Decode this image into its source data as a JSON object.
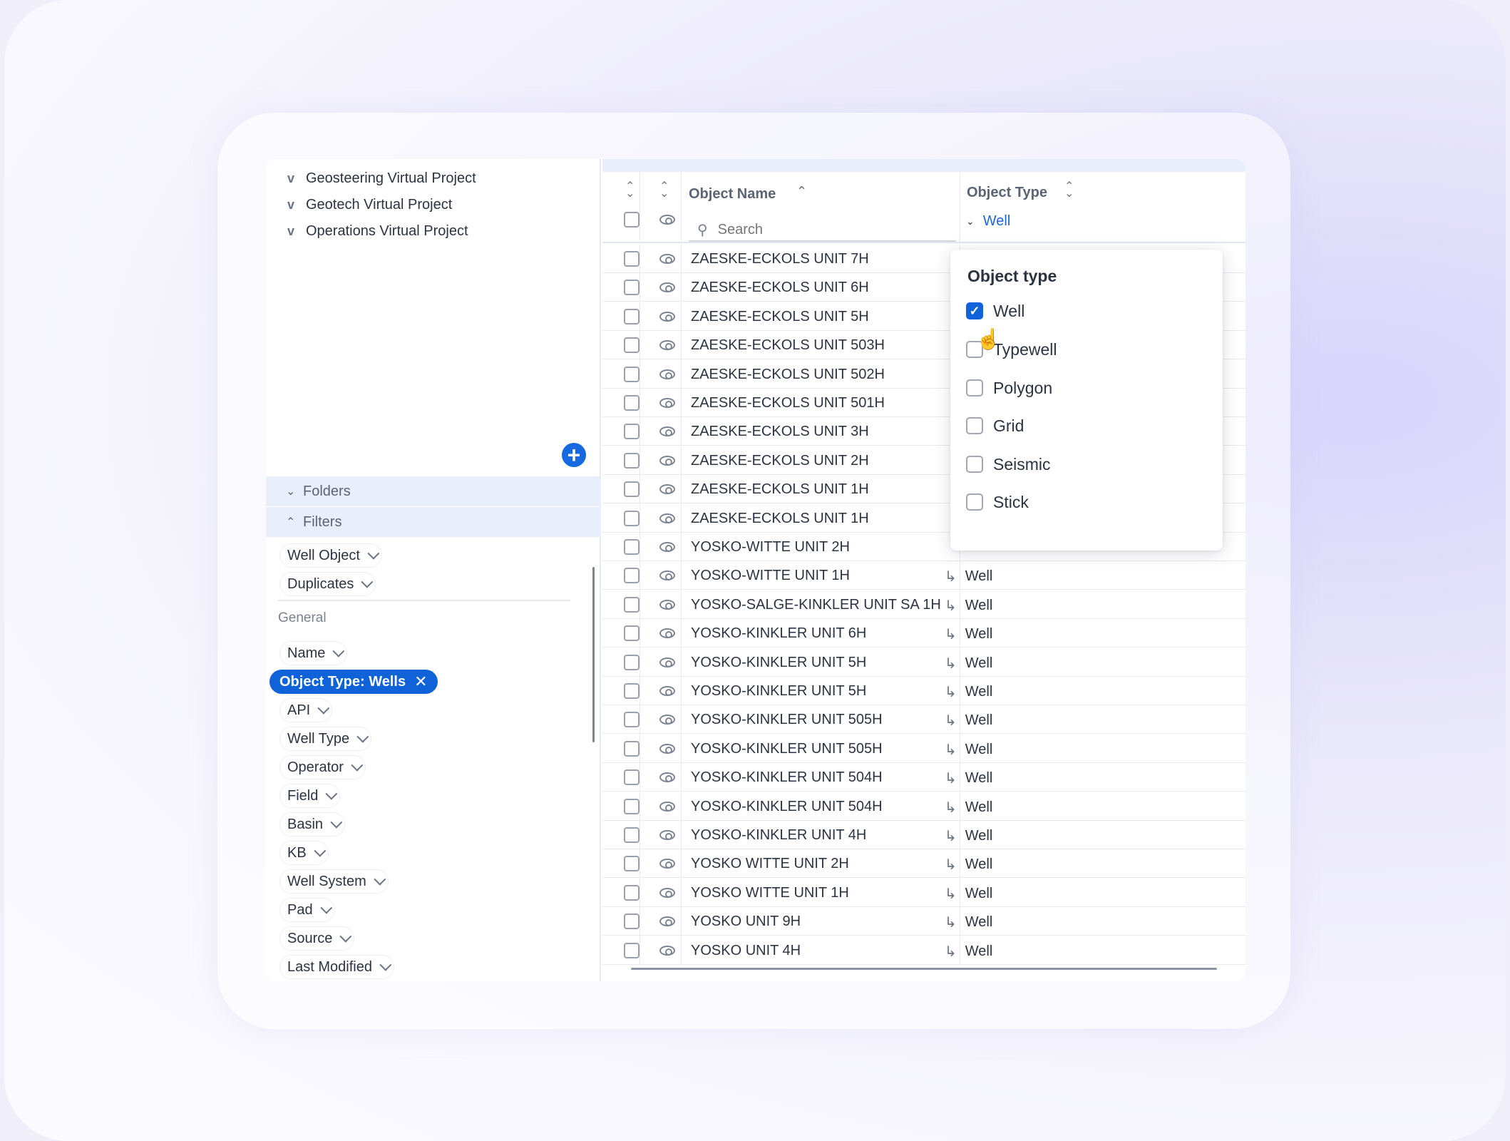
{
  "projects": [
    {
      "label": "Geosteering Virtual Project"
    },
    {
      "label": "Geotech Virtual Project"
    },
    {
      "label": "Operations Virtual Project"
    }
  ],
  "sections": {
    "folders": "Folders",
    "filters": "Filters"
  },
  "filters": {
    "top": [
      "Well Object",
      "Duplicates"
    ],
    "general_label": "General",
    "name": "Name",
    "active_chip": "Object Type: Wells",
    "items": [
      "API",
      "Well Type",
      "Operator",
      "Field",
      "Basin",
      "KB",
      "Well System",
      "Pad",
      "Source",
      "Last Modified"
    ]
  },
  "table": {
    "col_name": "Object Name",
    "col_type": "Object Type",
    "search_placeholder": "Search",
    "type_filter_value": "Well",
    "rows": [
      {
        "name": "ZAESKE-ECKOLS UNIT 7H",
        "type": ""
      },
      {
        "name": "ZAESKE-ECKOLS UNIT 6H",
        "type": ""
      },
      {
        "name": "ZAESKE-ECKOLS UNIT 5H",
        "type": ""
      },
      {
        "name": "ZAESKE-ECKOLS UNIT 503H",
        "type": ""
      },
      {
        "name": "ZAESKE-ECKOLS UNIT 502H",
        "type": ""
      },
      {
        "name": "ZAESKE-ECKOLS UNIT 501H",
        "type": ""
      },
      {
        "name": "ZAESKE-ECKOLS UNIT 3H",
        "type": ""
      },
      {
        "name": "ZAESKE-ECKOLS UNIT 2H",
        "type": ""
      },
      {
        "name": "ZAESKE-ECKOLS UNIT 1H",
        "type": ""
      },
      {
        "name": "ZAESKE-ECKOLS UNIT 1H",
        "type": ""
      },
      {
        "name": "YOSKO-WITTE UNIT 2H",
        "type": ""
      },
      {
        "name": "YOSKO-WITTE UNIT 1H",
        "type": "Well"
      },
      {
        "name": "YOSKO-SALGE-KINKLER UNIT SA 1H",
        "type": "Well"
      },
      {
        "name": "YOSKO-KINKLER UNIT 6H",
        "type": "Well"
      },
      {
        "name": "YOSKO-KINKLER UNIT 5H",
        "type": "Well"
      },
      {
        "name": "YOSKO-KINKLER UNIT 5H",
        "type": "Well"
      },
      {
        "name": "YOSKO-KINKLER UNIT 505H",
        "type": "Well"
      },
      {
        "name": "YOSKO-KINKLER UNIT 505H",
        "type": "Well"
      },
      {
        "name": "YOSKO-KINKLER UNIT 504H",
        "type": "Well"
      },
      {
        "name": "YOSKO-KINKLER UNIT 504H",
        "type": "Well"
      },
      {
        "name": "YOSKO-KINKLER UNIT 4H",
        "type": "Well"
      },
      {
        "name": "YOSKO WITTE UNIT 2H",
        "type": "Well"
      },
      {
        "name": "YOSKO WITTE UNIT 1H",
        "type": "Well"
      },
      {
        "name": "YOSKO UNIT 9H",
        "type": "Well"
      },
      {
        "name": "YOSKO UNIT 4H",
        "type": "Well"
      }
    ]
  },
  "popover": {
    "title": "Object type",
    "options": [
      {
        "label": "Well",
        "checked": true
      },
      {
        "label": "Typewell",
        "checked": false
      },
      {
        "label": "Polygon",
        "checked": false
      },
      {
        "label": "Grid",
        "checked": false
      },
      {
        "label": "Seismic",
        "checked": false
      },
      {
        "label": "Stick",
        "checked": false
      }
    ]
  },
  "colors": {
    "accent": "#1062d8",
    "section_bg": "#e9eefb"
  },
  "icons": [
    "chevron-down-icon",
    "chevron-up-icon",
    "plus-icon",
    "sort-icon",
    "eye-icon",
    "search-icon",
    "close-icon",
    "child-arrow-icon",
    "check-icon"
  ]
}
